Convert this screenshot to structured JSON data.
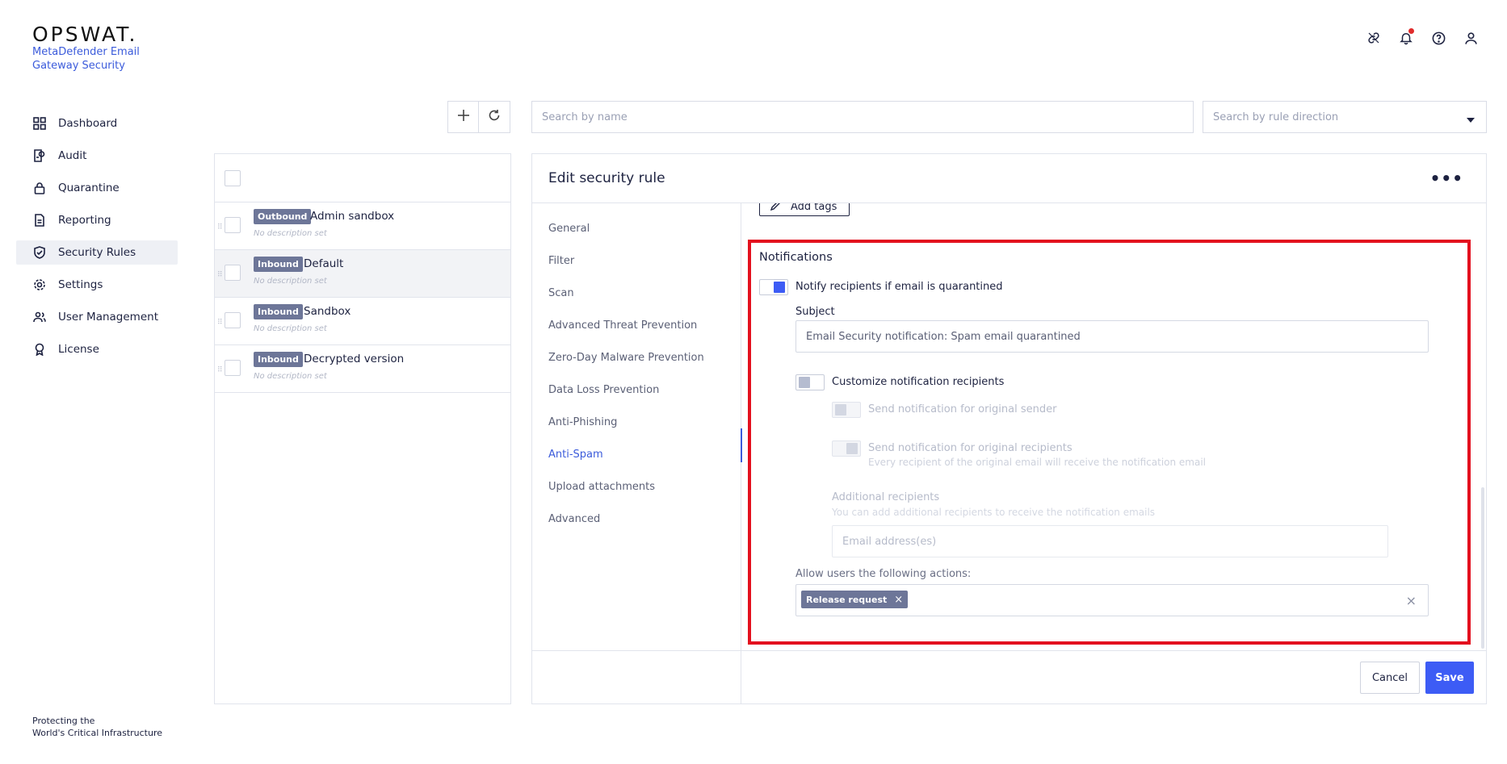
{
  "brand": {
    "logo": "OPSWAT.",
    "product_line1": "MetaDefender Email",
    "product_line2": "Gateway Security"
  },
  "top_icons": [
    "link-icon",
    "bell-icon",
    "help-icon",
    "user-icon"
  ],
  "nav": {
    "items": [
      {
        "label": "Dashboard",
        "icon": "dashboard-icon"
      },
      {
        "label": "Audit",
        "icon": "audit-icon"
      },
      {
        "label": "Quarantine",
        "icon": "lock-icon"
      },
      {
        "label": "Reporting",
        "icon": "document-icon"
      },
      {
        "label": "Security Rules",
        "icon": "shield-check-icon",
        "active": true
      },
      {
        "label": "Settings",
        "icon": "gear-icon"
      },
      {
        "label": "User Management",
        "icon": "users-icon"
      },
      {
        "label": "License",
        "icon": "award-icon"
      }
    ]
  },
  "footer": {
    "line1": "Protecting the",
    "line2": "World's Critical Infrastructure"
  },
  "toolbar": {
    "search_name_placeholder": "Search by name",
    "search_direction_placeholder": "Search by rule direction"
  },
  "rules": [
    {
      "direction": "Outbound",
      "name": "Admin sandbox",
      "description": "No description set"
    },
    {
      "direction": "Inbound",
      "name": "Default",
      "description": "No description set",
      "selected": true
    },
    {
      "direction": "Inbound",
      "name": "Sandbox",
      "description": "No description set"
    },
    {
      "direction": "Inbound",
      "name": "Decrypted version",
      "description": "No description set"
    }
  ],
  "editor": {
    "title": "Edit security rule",
    "menu": [
      "General",
      "Filter",
      "Scan",
      "Advanced Threat Prevention",
      "Zero-Day Malware Prevention",
      "Data Loss Prevention",
      "Anti-Phishing",
      "Anti-Spam",
      "Upload attachments",
      "Advanced"
    ],
    "active_menu": "Anti-Spam",
    "add_tags_label": "Add tags",
    "notifications": {
      "heading": "Notifications",
      "notify_label": "Notify recipients if email is quarantined",
      "notify_on": true,
      "subject_label": "Subject",
      "subject_value": "Email Security notification: Spam email quarantined",
      "customize_label": "Customize notification recipients",
      "customize_on": false,
      "original_sender_label": "Send notification for original sender",
      "original_recipients_label": "Send notification for original recipients",
      "original_recipients_help": "Every recipient of the original email will receive the notification email",
      "additional_label": "Additional recipients",
      "additional_help": "You can add additional recipients to receive the notification emails",
      "email_placeholder": "Email address(es)",
      "allow_label": "Allow users the following actions:",
      "allowed_actions": [
        "Release request"
      ]
    },
    "cancel_label": "Cancel",
    "save_label": "Save"
  },
  "colors": {
    "accent": "#3d5cf5",
    "badge": "#6d7698",
    "highlight_box": "#e3101e"
  }
}
